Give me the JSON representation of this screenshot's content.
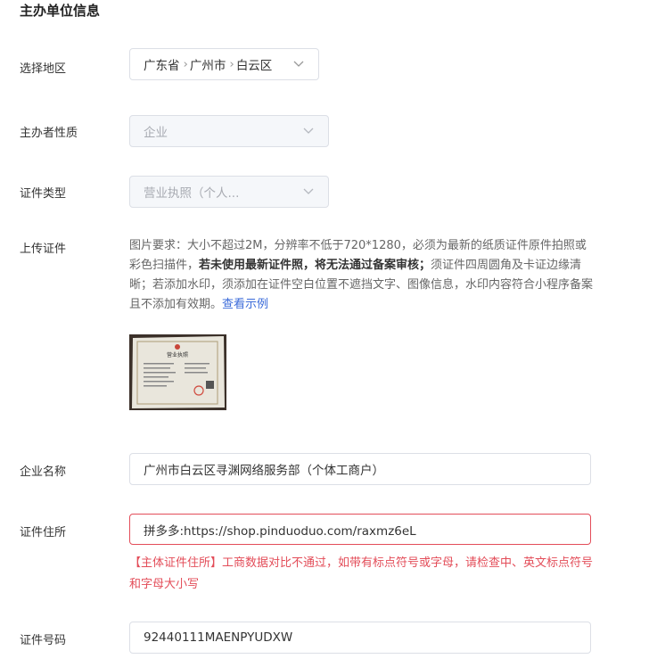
{
  "section": {
    "title": "主办单位信息"
  },
  "region": {
    "label": "选择地区",
    "province": "广东省",
    "city": "广州市",
    "district": "白云区"
  },
  "host_nature": {
    "label": "主办者性质",
    "value": "企业"
  },
  "cert_type": {
    "label": "证件类型",
    "value": "营业执照（个人..."
  },
  "upload": {
    "label": "上传证件",
    "desc_part1": "图片要求：大小不超过2M，分辨率不低于720*1280，必须为最新的纸质证件原件拍照或彩色扫描件，",
    "desc_bold": "若未使用最新证件照，将无法通过备案审核；",
    "desc_part2": "须证件四周圆角及卡证边缘清晰；若添加水印，须添加在证件空白位置不遮挡文字、图像信息，水印内容符合小程序备案且不添加有效期。",
    "example_link": "查看示例",
    "thumbnail": {
      "heading": "营业执照"
    }
  },
  "company_name": {
    "label": "企业名称",
    "value": "广州市白云区寻渊网络服务部（个体工商户）"
  },
  "cert_address": {
    "label": "证件住所",
    "value": "拼多多:https://shop.pinduoduo.com/raxmz6eL",
    "error": "【主体证件住所】工商数据对比不通过，如带有标点符号或字母，请检查中、英文标点符号和字母大小写"
  },
  "cert_number": {
    "label": "证件号码",
    "value": "92440111MAENPYUDXW"
  },
  "colors": {
    "error": "#e34d59",
    "link": "#3a6ad9",
    "border": "#dcdfe6",
    "disabled_bg": "#f5f7fa"
  },
  "icons": {
    "select_arrow": "chevron-down-icon"
  }
}
